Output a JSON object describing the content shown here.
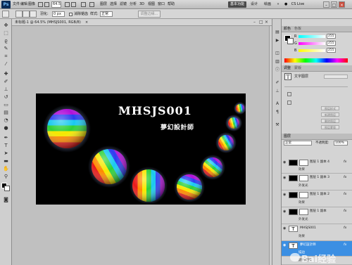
{
  "menubar": {
    "app_logo": "Ps",
    "zoom_value": "64.5",
    "workspace_buttons": [
      "基本功能",
      "设计",
      "绘画"
    ],
    "cs_live": "CS Live",
    "items": [
      "文件",
      "编辑",
      "图像",
      "图层",
      "选择",
      "滤镜",
      "分析",
      "3D",
      "视图",
      "窗口",
      "帮助"
    ]
  },
  "options": {
    "feather_label": "羽化:",
    "feather_value": "0 px",
    "antialias_label": "消除锯齿",
    "style_label": "样式:",
    "style_value": "正常",
    "refine_button": "调整边缘..."
  },
  "document": {
    "tab_title": "未标题-1 @ 64.5% (MHSJS001, RGB/8)",
    "tab_close": "×"
  },
  "canvas": {
    "title": "MHSJS001",
    "subtitle": "夢幻設計師"
  },
  "panels": {
    "color_tab": "颜色",
    "swatches_tab": "色板",
    "channels": [
      {
        "label": "R",
        "value": "255"
      },
      {
        "label": "G",
        "value": "255"
      },
      {
        "label": "B",
        "value": "255"
      }
    ],
    "adjust_tab": "调整",
    "masks_tab": "蒙版",
    "char_label": "文字图层",
    "char_glyph": "T",
    "prop_buttons": [
      "图层样式",
      "新建图层",
      "删除图层",
      "图层蒙版"
    ],
    "layers_tab": "图层",
    "blend_mode": "正常",
    "opacity_label": "不透明度:",
    "opacity_value": "100%",
    "layers": [
      {
        "name": "图层 1 副本 4",
        "sub": "效果"
      },
      {
        "name": "图层 1 副本 3",
        "sub": "外发光"
      },
      {
        "name": "图层 1 副本 2",
        "sub": "效果"
      },
      {
        "name": "图层 1 副本",
        "sub": "外发光"
      },
      {
        "name": "MHSJS001",
        "sub": "效果"
      },
      {
        "name": "夢幻設計師",
        "sub": "描边"
      }
    ],
    "selected_effect": "颜色叠加"
  },
  "watermark": {
    "text": "Bai经验"
  },
  "colors": {
    "accent": "#3b8fe3",
    "canvas_bg": "#000000"
  }
}
